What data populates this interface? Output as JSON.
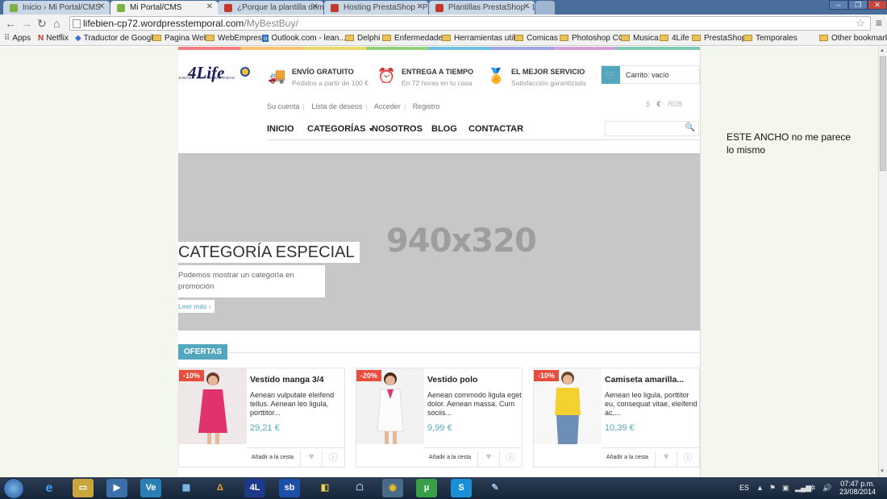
{
  "browser": {
    "tabs": [
      {
        "title": "Inicio › Mi Portal/CMS",
        "active": false,
        "favicon_color": "#7cb342"
      },
      {
        "title": "Mi Portal/CMS",
        "active": true,
        "favicon_color": "#7cb342"
      },
      {
        "title": "¿Porque la plantilla demo",
        "active": false,
        "favicon_color": "#c0392b"
      },
      {
        "title": "Hosting PrestaShop - Plan",
        "active": false,
        "favicon_color": "#c0392b"
      },
      {
        "title": "Plantillas PrestaShop - Lis",
        "active": false,
        "favicon_color": "#c0392b"
      }
    ],
    "url_host": "lifebien-cp72.wordpresstemporal.com",
    "url_path": "/MyBestBuy/",
    "bookmarks": [
      "Apps",
      "Netflix",
      "Traductor de Google",
      "Pagina Web",
      "WebEmpresa",
      "Outlook.com - lean...",
      "Delphi",
      "Enfermedades",
      "Herramientas utile",
      "Comicas",
      "Photoshop CC",
      "Musica",
      "4Life",
      "PrestaShop",
      "Temporales"
    ],
    "other_bookmarks": "Other bookmarks"
  },
  "store": {
    "logo_text": "4Life",
    "logo_tagline": "JUNTOS, EDIFICANDO VIDAS",
    "features": [
      {
        "title": "ENVÍO GRATUITO",
        "subtitle": "Pedidos a partir de 100 €",
        "icon": "truck-icon"
      },
      {
        "title": "ENTREGA A TIEMPO",
        "subtitle": "En 72 horas en tu casa",
        "icon": "clock-icon"
      },
      {
        "title": "EL MEJOR SERVICIO",
        "subtitle": "Satisfacción garantizada",
        "icon": "award-icon"
      }
    ],
    "cart_label": "Carrito: vacío",
    "user_links": [
      "Su cuenta",
      "Lista de deseos",
      "Acceder",
      "Registro"
    ],
    "currencies": [
      "$",
      "€",
      "RD$"
    ],
    "nav": [
      "INICIO",
      "CATEGORÍAS",
      "NOSOTROS",
      "BLOG",
      "CONTACTAR"
    ],
    "hero": {
      "placeholder": "940x320",
      "title": "CATEGORÍA ESPECIAL",
      "description": "Podemos mostrar un categoría en promoción",
      "more": "Leer más ›"
    },
    "offers_title": "OFERTAS",
    "products": [
      {
        "badge": "-10%",
        "name": "Vestido manga 3/4",
        "desc": "Aenean vulputate eleifend tellus. Aenean leo ligula, porttitor...",
        "price": "29,21 €",
        "add": "Añadir a la cesta",
        "color": "#e0336b"
      },
      {
        "badge": "-20%",
        "name": "Vestido polo",
        "desc": "Aenean commodo ligula eget dolor. Aenean massa. Cum sociis...",
        "price": "9,99 €",
        "add": "Añadir a la cesta",
        "color": "#f5f5f5"
      },
      {
        "badge": "-10%",
        "name": "Camiseta amarilla...",
        "desc": "Aenean leo ligula, porttitor eu, consequat vitae, eleifend ac,...",
        "price": "10,39 €",
        "add": "Añadir a la cesta",
        "color": "#f3d22f"
      }
    ]
  },
  "side_note": "ESTE ANCHO no me parece lo mismo",
  "taskbar": {
    "lang": "ES",
    "time": "07:47 p.m.",
    "date": "23/08/2014"
  }
}
